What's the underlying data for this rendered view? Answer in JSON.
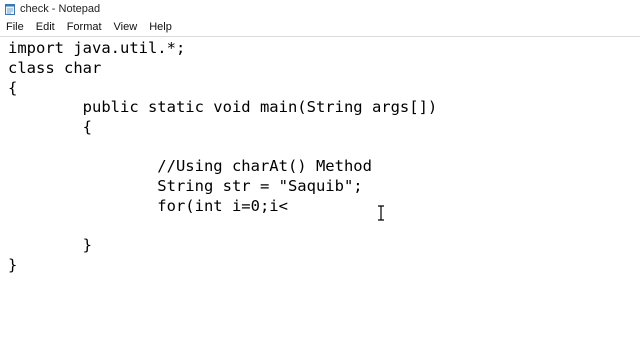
{
  "window": {
    "title": "check - Notepad",
    "app_icon": "notepad-icon"
  },
  "menu": {
    "items": [
      "File",
      "Edit",
      "Format",
      "View",
      "Help"
    ]
  },
  "editor": {
    "lines": [
      "import java.util.*;",
      "class char",
      "{",
      "        public static void main(String args[])",
      "        {",
      "",
      "                //Using charAt() Method",
      "                String str = \"Saquib\";",
      "                for(int i=0;i<",
      "",
      "        }",
      "}"
    ]
  },
  "cursor": {
    "icon": "text-ibeam-cursor-icon"
  }
}
